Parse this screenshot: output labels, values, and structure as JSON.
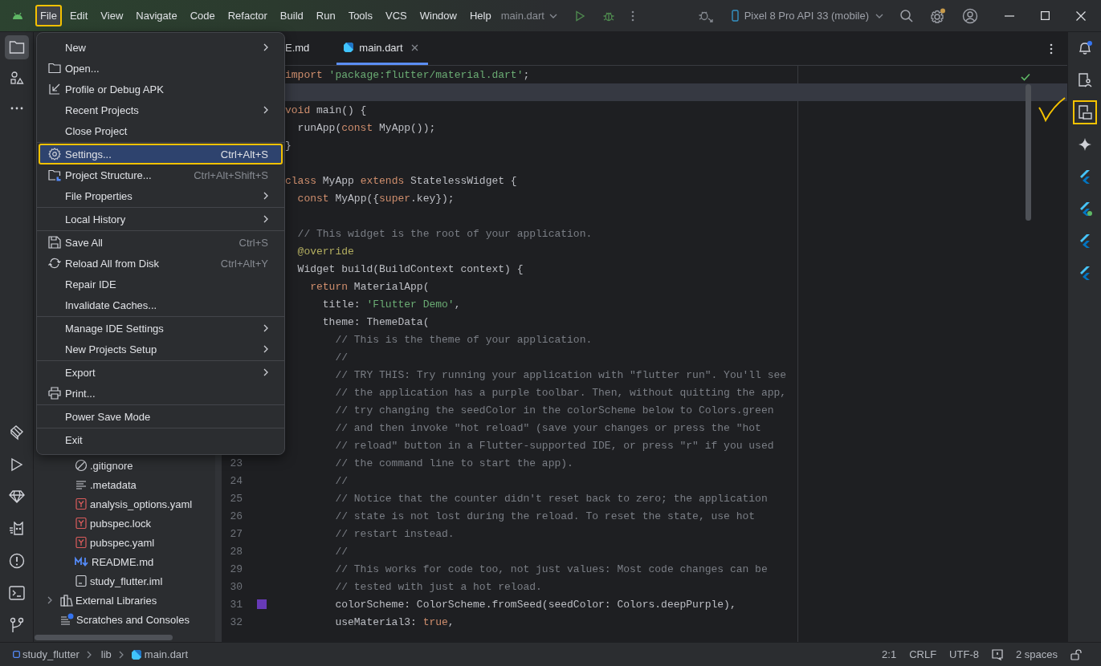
{
  "title_bar": {
    "menu": [
      {
        "label": "File",
        "selected": true,
        "annotated": true
      },
      {
        "label": "Edit",
        "selected": false,
        "annotated": false
      },
      {
        "label": "View",
        "selected": false,
        "annotated": false
      },
      {
        "label": "Navigate",
        "selected": false,
        "annotated": false
      },
      {
        "label": "Code",
        "selected": false,
        "annotated": false
      },
      {
        "label": "Refactor",
        "selected": false,
        "annotated": false
      },
      {
        "label": "Build",
        "selected": false,
        "annotated": false
      },
      {
        "label": "Run",
        "selected": false,
        "annotated": false
      },
      {
        "label": "Tools",
        "selected": false,
        "annotated": false
      },
      {
        "label": "VCS",
        "selected": false,
        "annotated": false
      },
      {
        "label": "Window",
        "selected": false,
        "annotated": false
      },
      {
        "label": "Help",
        "selected": false,
        "annotated": false
      }
    ],
    "project_widget": "main.dart",
    "device": "Pixel 8 Pro API 33 (mobile)",
    "settings_badge": true
  },
  "left_toolbar": {
    "top": [
      {
        "kind": "folder",
        "selected": true
      },
      {
        "kind": "shapes",
        "selected": false
      },
      {
        "kind": "more",
        "selected": false
      }
    ],
    "bottom": [
      {
        "kind": "build",
        "selected": false
      },
      {
        "kind": "run",
        "selected": false
      },
      {
        "kind": "gem",
        "selected": false
      },
      {
        "kind": "cat",
        "selected": false
      },
      {
        "kind": "problems",
        "selected": false
      },
      {
        "kind": "terminal",
        "selected": false
      },
      {
        "kind": "git",
        "selected": false
      }
    ]
  },
  "file_menu": {
    "groups": [
      [
        {
          "label": "New",
          "submenu": true,
          "selected": false
        },
        {
          "label": "Open...",
          "kind": "folder",
          "submenu": false,
          "selected": false
        },
        {
          "label": "Profile or Debug APK",
          "kind": "import",
          "submenu": false,
          "selected": false
        },
        {
          "label": "Recent Projects",
          "submenu": true,
          "selected": false
        },
        {
          "label": "Close Project",
          "submenu": false,
          "selected": false
        }
      ],
      [
        {
          "label": "Settings...",
          "kind": "gear",
          "shortcut": "Ctrl+Alt+S",
          "submenu": false,
          "selected": true,
          "annotated": true
        },
        {
          "label": "Project Structure...",
          "kind": "structure",
          "shortcut": "Ctrl+Alt+Shift+S",
          "submenu": false,
          "selected": false
        },
        {
          "label": "File Properties",
          "submenu": true,
          "selected": false
        }
      ],
      [
        {
          "label": "Local History",
          "submenu": true,
          "selected": false
        }
      ],
      [
        {
          "label": "Save All",
          "kind": "save",
          "shortcut": "Ctrl+S",
          "submenu": false,
          "selected": false
        },
        {
          "label": "Reload All from Disk",
          "kind": "reload",
          "shortcut": "Ctrl+Alt+Y",
          "submenu": false,
          "selected": false
        },
        {
          "label": "Repair IDE",
          "submenu": false,
          "selected": false
        },
        {
          "label": "Invalidate Caches...",
          "submenu": false,
          "selected": false
        }
      ],
      [
        {
          "label": "Manage IDE Settings",
          "submenu": true,
          "selected": false
        },
        {
          "label": "New Projects Setup",
          "submenu": true,
          "selected": false
        }
      ],
      [
        {
          "label": "Export",
          "submenu": true,
          "selected": false
        },
        {
          "label": "Print...",
          "kind": "print",
          "submenu": false,
          "selected": false
        }
      ],
      [
        {
          "label": "Power Save Mode",
          "submenu": false,
          "selected": false
        }
      ],
      [
        {
          "label": "Exit",
          "submenu": false,
          "selected": false
        }
      ]
    ]
  },
  "project_tree": {
    "items": [
      {
        "children": [
          {
            "label": ".gitignore",
            "kind": "ignore"
          },
          {
            "label": ".metadata",
            "kind": "text"
          },
          {
            "label": "analysis_options.yaml",
            "kind": "yaml"
          },
          {
            "label": "pubspec.lock",
            "kind": "yaml"
          },
          {
            "label": "pubspec.yaml",
            "kind": "yaml"
          },
          {
            "label": "README.md",
            "kind": "markdown"
          },
          {
            "label": "study_flutter.iml",
            "kind": "module"
          }
        ]
      },
      {
        "label": "External Libraries",
        "kind": "library",
        "expanded": false
      },
      {
        "label": "Scratches and Consoles",
        "kind": "scratch"
      }
    ]
  },
  "editor": {
    "tabs": [
      {
        "label": "E.md",
        "selected": false
      },
      {
        "label": "main.dart",
        "selected": true
      }
    ],
    "lines": [
      {
        "current": false,
        "tokens": [
          {
            "kind": "kw",
            "text": "import "
          },
          {
            "kind": "str",
            "text": "'package:flutter/material.dart'"
          },
          {
            "kind": "plain",
            "text": ";"
          }
        ]
      },
      {
        "current": true
      },
      {
        "current": false,
        "tokens": [
          {
            "kind": "kw",
            "text": "void "
          },
          {
            "kind": "plain",
            "text": "main() {"
          }
        ]
      },
      {
        "current": false,
        "tokens": [
          {
            "kind": "plain",
            "text": "  runApp("
          },
          {
            "kind": "kw",
            "text": "const "
          },
          {
            "kind": "plain",
            "text": "MyApp());"
          }
        ]
      },
      {
        "current": false,
        "tokens": [
          {
            "kind": "plain",
            "text": "}"
          }
        ]
      },
      {
        "current": false
      },
      {
        "current": false,
        "tokens": [
          {
            "kind": "kw",
            "text": "class "
          },
          {
            "kind": "plain",
            "text": "MyApp "
          },
          {
            "kind": "kw",
            "text": "extends "
          },
          {
            "kind": "plain",
            "text": "StatelessWidget {"
          }
        ]
      },
      {
        "current": false,
        "tokens": [
          {
            "kind": "kw",
            "text": "  const "
          },
          {
            "kind": "plain",
            "text": "MyApp({"
          },
          {
            "kind": "kw",
            "text": "super"
          },
          {
            "kind": "plain",
            "text": ".key});"
          }
        ]
      },
      {
        "current": false
      },
      {
        "current": false,
        "tokens": [
          {
            "kind": "cm",
            "text": "  // This widget is the root of your application."
          }
        ]
      },
      {
        "current": false,
        "tokens": [
          {
            "kind": "ann",
            "text": "  @override"
          }
        ]
      },
      {
        "current": false,
        "tokens": [
          {
            "kind": "plain",
            "text": "  Widget build(BuildContext context) {"
          }
        ]
      },
      {
        "current": false,
        "tokens": [
          {
            "kind": "kw",
            "text": "    return "
          },
          {
            "kind": "plain",
            "text": "MaterialApp("
          }
        ]
      },
      {
        "current": false,
        "tokens": [
          {
            "kind": "plain",
            "text": "      title: "
          },
          {
            "kind": "str",
            "text": "'Flutter Demo'"
          },
          {
            "kind": "plain",
            "text": ","
          }
        ]
      },
      {
        "current": false,
        "tokens": [
          {
            "kind": "plain",
            "text": "      theme: ThemeData("
          }
        ]
      },
      {
        "current": false,
        "tokens": [
          {
            "kind": "cm",
            "text": "        // This is the theme of your application."
          }
        ]
      },
      {
        "current": false,
        "tokens": [
          {
            "kind": "cm",
            "text": "        //"
          }
        ]
      },
      {
        "current": false,
        "tokens": [
          {
            "kind": "cm",
            "text": "        // TRY THIS: Try running your application with \"flutter run\". You'll see"
          }
        ]
      },
      {
        "current": false,
        "tokens": [
          {
            "kind": "cm",
            "text": "        // the application has a purple toolbar. Then, without quitting the app,"
          }
        ]
      },
      {
        "current": false,
        "tokens": [
          {
            "kind": "cm",
            "text": "        // try changing the seedColor in the colorScheme below to Colors.green"
          }
        ]
      },
      {
        "current": false,
        "tokens": [
          {
            "kind": "cm",
            "text": "        // and then invoke \"hot reload\" (save your changes or press the \"hot"
          }
        ]
      },
      {
        "current": false,
        "tokens": [
          {
            "kind": "cm",
            "text": "        // reload\" button in a Flutter-supported IDE, or press \"r\" if you used"
          }
        ]
      },
      {
        "number": "23",
        "current": false,
        "tokens": [
          {
            "kind": "cm",
            "text": "        // the command line to start the app)."
          }
        ]
      },
      {
        "number": "24",
        "current": false,
        "tokens": [
          {
            "kind": "cm",
            "text": "        //"
          }
        ]
      },
      {
        "number": "25",
        "current": false,
        "tokens": [
          {
            "kind": "cm",
            "text": "        // Notice that the counter didn't reset back to zero; the application"
          }
        ]
      },
      {
        "number": "26",
        "current": false,
        "tokens": [
          {
            "kind": "cm",
            "text": "        // state is not lost during the reload. To reset the state, use hot"
          }
        ]
      },
      {
        "number": "27",
        "current": false,
        "tokens": [
          {
            "kind": "cm",
            "text": "        // restart instead."
          }
        ]
      },
      {
        "number": "28",
        "current": false,
        "tokens": [
          {
            "kind": "cm",
            "text": "        //"
          }
        ]
      },
      {
        "number": "29",
        "current": false,
        "tokens": [
          {
            "kind": "cm",
            "text": "        // This works for code too, not just values: Most code changes can be"
          }
        ]
      },
      {
        "number": "30",
        "current": false,
        "tokens": [
          {
            "kind": "cm",
            "text": "        // tested with just a hot reload."
          }
        ]
      },
      {
        "number": "31",
        "current": false,
        "color": "#673ab7",
        "tokens": [
          {
            "kind": "plain",
            "text": "        colorScheme: ColorScheme.fromSeed(seedColor: Colors.deepPurple),"
          }
        ]
      },
      {
        "number": "32",
        "current": false,
        "tokens": [
          {
            "kind": "plain",
            "text": "        useMaterial3: "
          },
          {
            "kind": "kw",
            "text": "true"
          },
          {
            "kind": "plain",
            "text": ","
          }
        ]
      }
    ]
  },
  "right_toolbar": [
    {
      "kind": "bell",
      "color": "#3574f0",
      "annotated": false
    },
    {
      "kind": "device-mirror",
      "annotated": false
    },
    {
      "kind": "device-manager",
      "annotated": true
    },
    {
      "kind": "sparkle",
      "annotated": false
    },
    {
      "kind": "flutter",
      "annotated": false
    },
    {
      "kind": "flutter",
      "color": "#5fb865",
      "annotated": false
    },
    {
      "kind": "flutter",
      "annotated": false
    },
    {
      "kind": "flutter",
      "annotated": false
    }
  ],
  "status_bar": {
    "breadcrumbs": [
      {
        "label": "study_flutter",
        "kind": "module"
      },
      {
        "label": "lib"
      },
      {
        "label": "main.dart",
        "kind": "dart"
      }
    ],
    "position": "2:1",
    "line_separator": "CRLF",
    "encoding": "UTF-8",
    "indent": "2 spaces"
  }
}
